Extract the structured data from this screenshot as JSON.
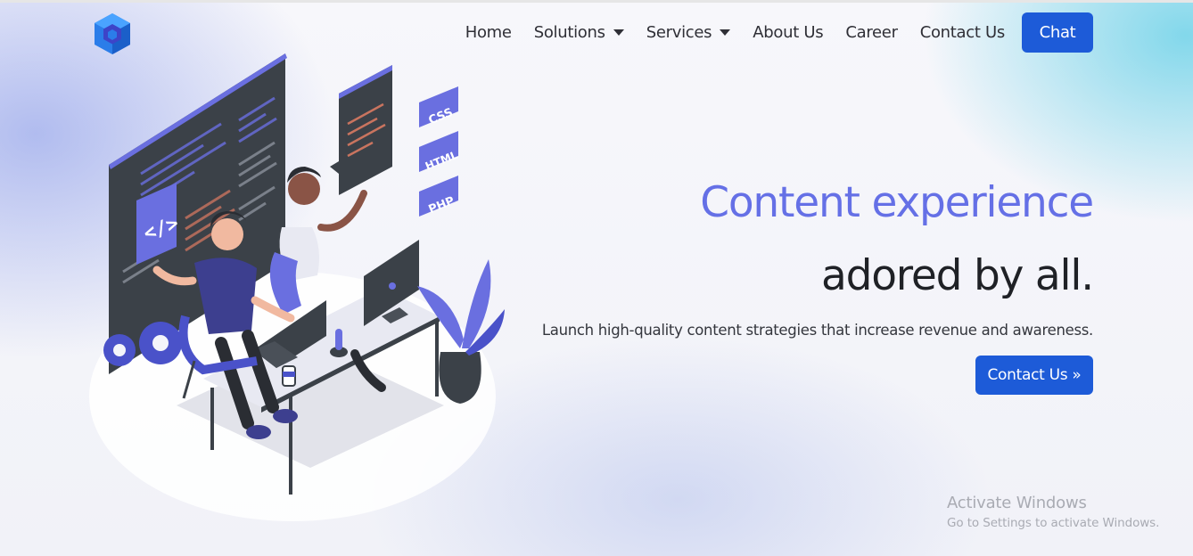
{
  "navbar": {
    "logo_icon": "cube-logo-icon",
    "links": [
      {
        "label": "Home",
        "dropdown": false
      },
      {
        "label": "Solutions",
        "dropdown": true
      },
      {
        "label": "Services",
        "dropdown": true
      },
      {
        "label": "About Us",
        "dropdown": false
      },
      {
        "label": "Career",
        "dropdown": false
      },
      {
        "label": "Contact Us",
        "dropdown": false
      }
    ],
    "chat_label": "Chat"
  },
  "hero": {
    "headline_line1": "Content experience",
    "headline_line2": "adored by all.",
    "subtext": "Launch high-quality content strategies that increase revenue and awareness.",
    "cta_label": "Contact Us »",
    "illustration": {
      "icon": "developers-at-desk-illustration",
      "code_badge": "</>",
      "tags": [
        "CSS",
        "HTML",
        "PHP"
      ]
    }
  },
  "watermark": {
    "title": "Activate Windows",
    "subtitle": "Go to Settings to activate Windows."
  },
  "colors": {
    "accent": "#1d5bd8",
    "headline_accent": "#6570e6",
    "illustration_purple": "#6a6fe0",
    "dark_screen": "#3b4148"
  }
}
